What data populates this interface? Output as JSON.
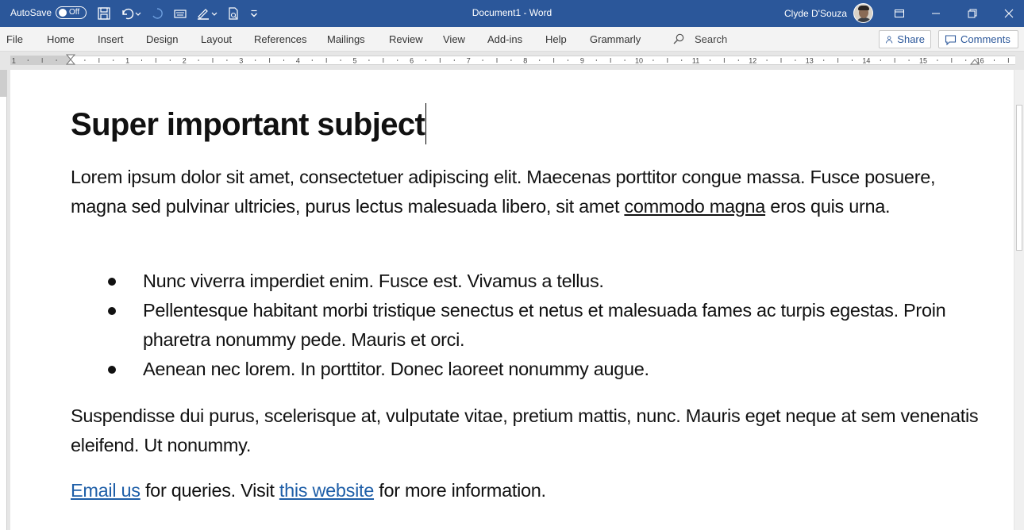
{
  "titlebar": {
    "autosave_label": "AutoSave",
    "autosave_state": "Off",
    "document_title": "Document1 - Word",
    "user_name": "Clyde D'Souza"
  },
  "menu": {
    "tabs": [
      "File",
      "Home",
      "Insert",
      "Design",
      "Layout",
      "References",
      "Mailings",
      "Review",
      "View",
      "Add-ins",
      "Help",
      "Grammarly"
    ],
    "search_label": "Search",
    "share_label": "Share",
    "comments_label": "Comments"
  },
  "ruler": {
    "numbers": [
      "1",
      "1",
      "2",
      "3",
      "4",
      "5",
      "6",
      "7",
      "8",
      "9",
      "10",
      "11",
      "12",
      "13",
      "14",
      "15",
      "16"
    ]
  },
  "document": {
    "heading": "Super important subject",
    "para1_a": "Lorem ipsum dolor sit amet, consectetuer adipiscing elit. Maecenas porttitor congue massa. Fusce posuere, magna sed pulvinar ultricies, purus lectus malesuada libero, sit amet ",
    "para1_underlined": "commodo magna",
    "para1_b": " eros quis urna.",
    "bullets": [
      "Nunc viverra imperdiet enim. Fusce est. Vivamus a tellus.",
      "Pellentesque habitant morbi tristique senectus et netus et malesuada fames ac turpis egestas. Proin pharetra nonummy pede. Mauris et orci.",
      "Aenean nec lorem. In porttitor. Donec laoreet nonummy augue."
    ],
    "para2": "Suspendisse dui purus, scelerisque at, vulputate vitae, pretium mattis, nunc. Mauris eget neque at sem venenatis eleifend. Ut nonummy.",
    "para3_link1": "Email us",
    "para3_text1": " for queries. Visit ",
    "para3_link2": "this website",
    "para3_text2": " for more information."
  },
  "colors": {
    "titlebar": "#2b579a",
    "link": "#1f5fa8"
  }
}
